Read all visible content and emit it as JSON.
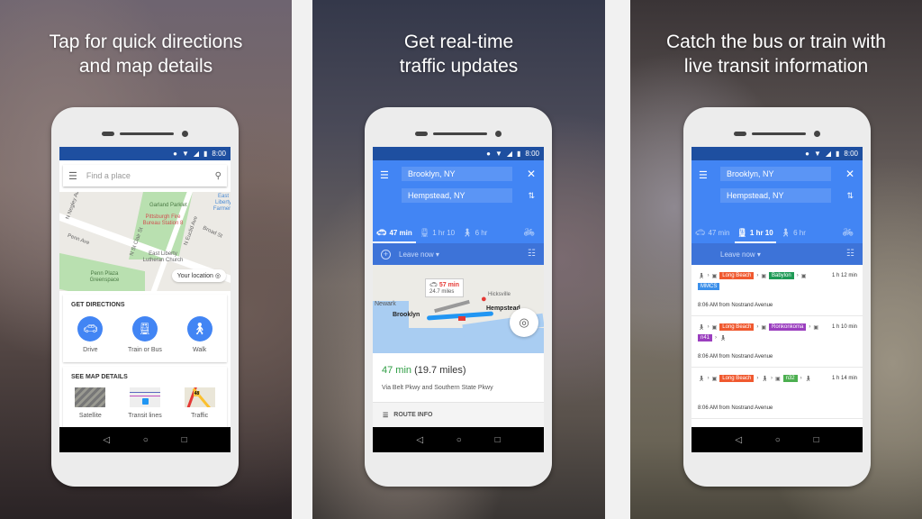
{
  "panels": [
    {
      "headline": [
        "Tap for quick directions",
        "and map details"
      ],
      "status_time": "8:00",
      "search_placeholder": "Find a place",
      "map_labels": {
        "park1": "Garland Parklet",
        "poi1": "Pittsburgh Fire Bureau Station 8",
        "street1": "Penn Ave",
        "street2": "N Negley Ave",
        "street3": "N St Clair St",
        "street4": "N Euclid Ave",
        "street5": "Broad St",
        "poi2": "East Liberty Lutheran Church",
        "park2": "Penn Plaza Greenspace",
        "poi3": "East Liberty Farmers",
        "your_location": "Your location"
      },
      "get_directions": {
        "title": "GET DIRECTIONS",
        "items": [
          {
            "label": "Drive",
            "icon": "car-icon"
          },
          {
            "label": "Train or Bus",
            "icon": "train-icon"
          },
          {
            "label": "Walk",
            "icon": "walk-icon"
          }
        ]
      },
      "map_details": {
        "title": "SEE MAP DETAILS",
        "items": [
          {
            "label": "Satellite"
          },
          {
            "label": "Transit lines"
          },
          {
            "label": "Traffic",
            "badge": "48"
          }
        ]
      }
    },
    {
      "headline": [
        "Get real-time",
        "traffic updates"
      ],
      "status_time": "8:00",
      "origin": "Brooklyn, NY",
      "destination": "Hempstead, NY",
      "modes": [
        {
          "icon": "car-icon",
          "label": "47 min",
          "active": true
        },
        {
          "icon": "train-icon",
          "label": "1 hr 10",
          "active": false
        },
        {
          "icon": "walk-icon",
          "label": "6 hr",
          "active": false
        }
      ],
      "leave_label": "Leave now",
      "map": {
        "origin_label": "Brooklyn",
        "dest_label": "Hempstead",
        "newark": "Newark",
        "hicksville": "Hicksville",
        "alt_time": "57 min",
        "alt_dist": "24.7 miles"
      },
      "eta_time": "47 min",
      "eta_dist": "(19.7 miles)",
      "via": "Via Belt Pkwy and Southern State Pkwy",
      "route_info": "ROUTE INFO"
    },
    {
      "headline": [
        "Catch the bus or train with",
        "live transit information"
      ],
      "status_time": "8:00",
      "origin": "Brooklyn, NY",
      "destination": "Hempstead, NY",
      "modes": [
        {
          "icon": "car-icon",
          "label": "47 min",
          "active": false
        },
        {
          "icon": "train-icon",
          "label": "1 hr 10",
          "active": true
        },
        {
          "icon": "walk-icon",
          "label": "6 hr",
          "active": false
        }
      ],
      "leave_label": "Leave now",
      "routes": [
        {
          "duration": "1 h 12 min",
          "departure": "8:06 AM from Nostrand Avenue",
          "tags": [
            {
              "text": "Long Beach",
              "color": "#f0592f"
            },
            {
              "text": "Babylon",
              "color": "#1f9a56"
            },
            {
              "text": "MMCS",
              "color": "#3b8fea"
            }
          ]
        },
        {
          "duration": "1 h 10 min",
          "departure": "8:06 AM from Nostrand Avenue",
          "tags": [
            {
              "text": "Long Beach",
              "color": "#f0592f"
            },
            {
              "text": "Ronkonkoma",
              "color": "#9b3fbf"
            },
            {
              "text": "n41",
              "color": "#9b3fbf"
            }
          ]
        },
        {
          "duration": "1 h 14 min",
          "departure": "8:06 AM from Nostrand Avenue",
          "tags": [
            {
              "text": "Long Beach",
              "color": "#f0592f"
            },
            {
              "text": "n32",
              "color": "#4caf50"
            }
          ]
        }
      ]
    }
  ],
  "colors": {
    "status_bar": "#1e4fa0",
    "primary_blue": "#4285f4",
    "eta_green": "#2f9e44",
    "traffic_red": "#e53935"
  }
}
